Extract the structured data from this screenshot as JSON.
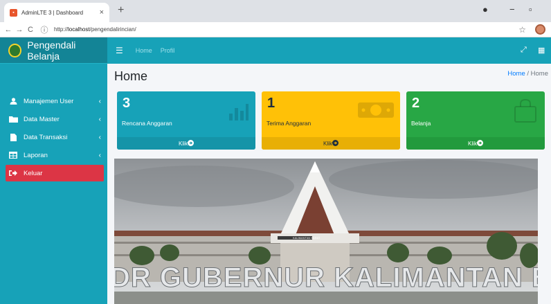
{
  "browser": {
    "tab_title": "AdminLTE 3 | Dashboard",
    "tab_close": "×",
    "new_tab": "+",
    "url_prefix": "http://",
    "url_host": "localhost",
    "url_path": "/pengendalirincian/"
  },
  "brand": {
    "name": "Pengendali Belanja"
  },
  "navbar": {
    "links": [
      "Home",
      "Profil"
    ]
  },
  "sidebar": {
    "items": [
      {
        "label": "Manajemen User",
        "icon": "user-icon",
        "has_chevron": true
      },
      {
        "label": "Data Master",
        "icon": "folder-icon",
        "has_chevron": true
      },
      {
        "label": "Data Transaksi",
        "icon": "file-icon",
        "has_chevron": true
      },
      {
        "label": "Laporan",
        "icon": "table-icon",
        "has_chevron": true
      },
      {
        "label": "Keluar",
        "icon": "sign-out-icon",
        "has_chevron": false
      }
    ]
  },
  "page": {
    "title": "Home",
    "breadcrumb": [
      "Home",
      "Home"
    ]
  },
  "boxes": [
    {
      "count": "3",
      "label": "Rencana Anggaran",
      "link": "Klik",
      "color": "#17a2b8",
      "icon": "bar-chart-icon"
    },
    {
      "count": "1",
      "label": "Terima Anggaran",
      "link": "Klik",
      "color": "#ffc107",
      "icon": "money-icon"
    },
    {
      "count": "2",
      "label": "Belanja",
      "link": "Klik",
      "color": "#28a745",
      "icon": "shopping-bag-icon"
    }
  ],
  "banner": {
    "sign_text": "DR GUBERNUR KALIMANTAN BARA",
    "small_sign": "KALIMANTAN BARAT"
  }
}
